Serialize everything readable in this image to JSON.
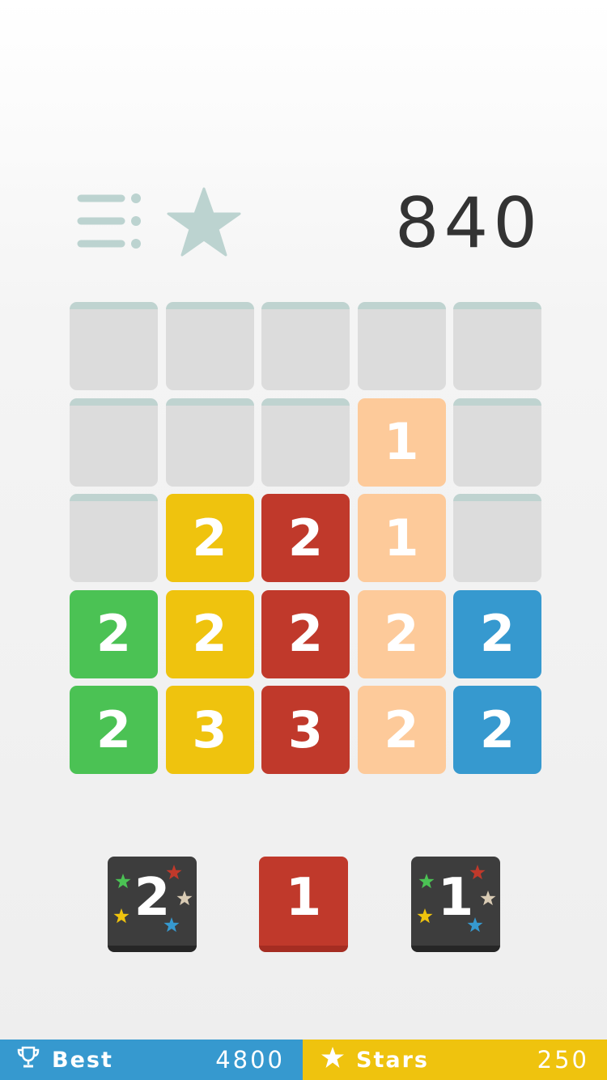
{
  "header": {
    "score": "840",
    "menu_icon": "menu-icon",
    "star_icon": "star-icon",
    "icon_color": "#bcd3d0"
  },
  "board": {
    "rows": [
      [
        "",
        "",
        "",
        "",
        ""
      ],
      [
        "",
        "",
        "",
        "1",
        ""
      ],
      [
        "",
        "2",
        "2",
        "1",
        ""
      ],
      [
        "2",
        "2",
        "2",
        "2",
        "2"
      ],
      [
        "2",
        "3",
        "3",
        "2",
        "2"
      ]
    ],
    "colors": [
      [
        "empty",
        "empty",
        "empty",
        "empty",
        "empty"
      ],
      [
        "empty",
        "empty",
        "empty",
        "peach",
        "empty"
      ],
      [
        "empty",
        "yellow",
        "red",
        "peach",
        "empty"
      ],
      [
        "green",
        "yellow",
        "red",
        "peach",
        "blue"
      ],
      [
        "green",
        "yellow",
        "red",
        "peach",
        "blue"
      ]
    ]
  },
  "palette": {
    "green": "#4bc254",
    "yellow": "#efc30e",
    "red": "#c0392b",
    "peach": "#fdca9a",
    "blue": "#3699cf",
    "empty": "#dcdcdc",
    "dark": "#3d3d3d"
  },
  "next_tiles": [
    {
      "value": "2",
      "style": "dark",
      "stars": true
    },
    {
      "value": "1",
      "style": "red",
      "stars": false
    },
    {
      "value": "1",
      "style": "dark",
      "stars": true
    }
  ],
  "footer": {
    "best_label": "Best",
    "best_value": "4800",
    "best_icon": "trophy-icon",
    "stars_label": "Stars",
    "stars_value": "250",
    "stars_icon": "star-icon"
  }
}
